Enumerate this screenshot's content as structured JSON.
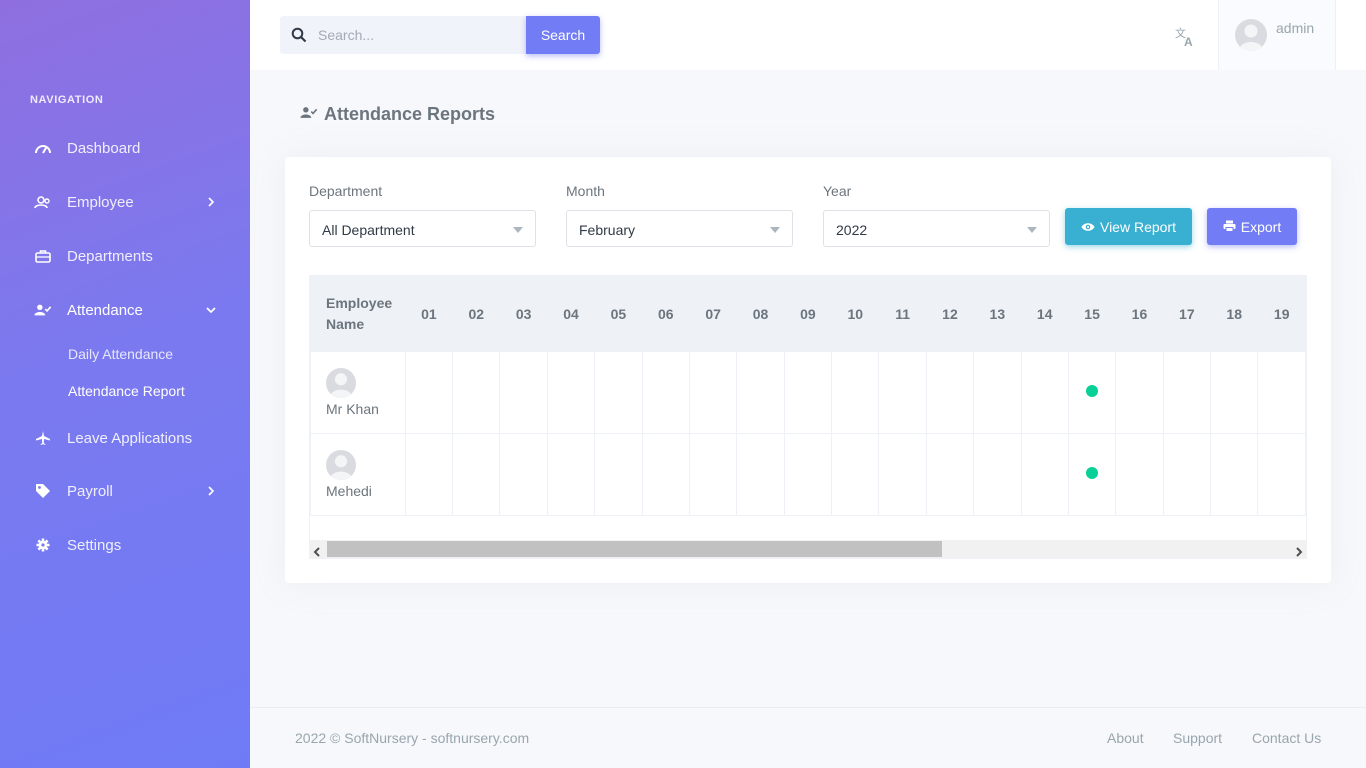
{
  "sidebar": {
    "heading": "NAVIGATION",
    "items": [
      {
        "label": "Dashboard",
        "icon": "gauge-icon"
      },
      {
        "label": "Employee",
        "icon": "users-icon",
        "has_chevron": true
      },
      {
        "label": "Departments",
        "icon": "briefcase-icon"
      },
      {
        "label": "Attendance",
        "icon": "user-check-icon",
        "expanded": true
      },
      {
        "label": "Leave Applications",
        "icon": "airplane-icon"
      },
      {
        "label": "Payroll",
        "icon": "tag-icon",
        "has_chevron": true
      },
      {
        "label": "Settings",
        "icon": "gear-icon"
      }
    ],
    "attendance_sub": [
      {
        "label": "Daily Attendance"
      },
      {
        "label": "Attendance Report",
        "active": true
      }
    ]
  },
  "topbar": {
    "search_placeholder": "Search...",
    "search_button": "Search",
    "user_name": "admin"
  },
  "page": {
    "title": "Attendance Reports"
  },
  "filters": {
    "department": {
      "label": "Department",
      "value": "All Department"
    },
    "month": {
      "label": "Month",
      "value": "February"
    },
    "year": {
      "label": "Year",
      "value": "2022"
    },
    "view_report": "View Report",
    "export": "Export"
  },
  "table": {
    "employee_header_line1": "Employee",
    "employee_header_line2": "Name",
    "days": [
      "01",
      "02",
      "03",
      "04",
      "05",
      "06",
      "07",
      "08",
      "09",
      "10",
      "11",
      "12",
      "13",
      "14",
      "15",
      "16",
      "17",
      "18",
      "19"
    ],
    "rows": [
      {
        "name": "Mr Khan",
        "present_days": [
          "15"
        ]
      },
      {
        "name": "Mehedi",
        "present_days": [
          "15"
        ]
      }
    ]
  },
  "footer": {
    "copyright": "2022 © SoftNursery - softnursery.com",
    "links": [
      "About",
      "Support",
      "Contact Us"
    ]
  },
  "colors": {
    "primary": "#727cf5",
    "info": "#39afd1",
    "success": "#0acf97"
  }
}
